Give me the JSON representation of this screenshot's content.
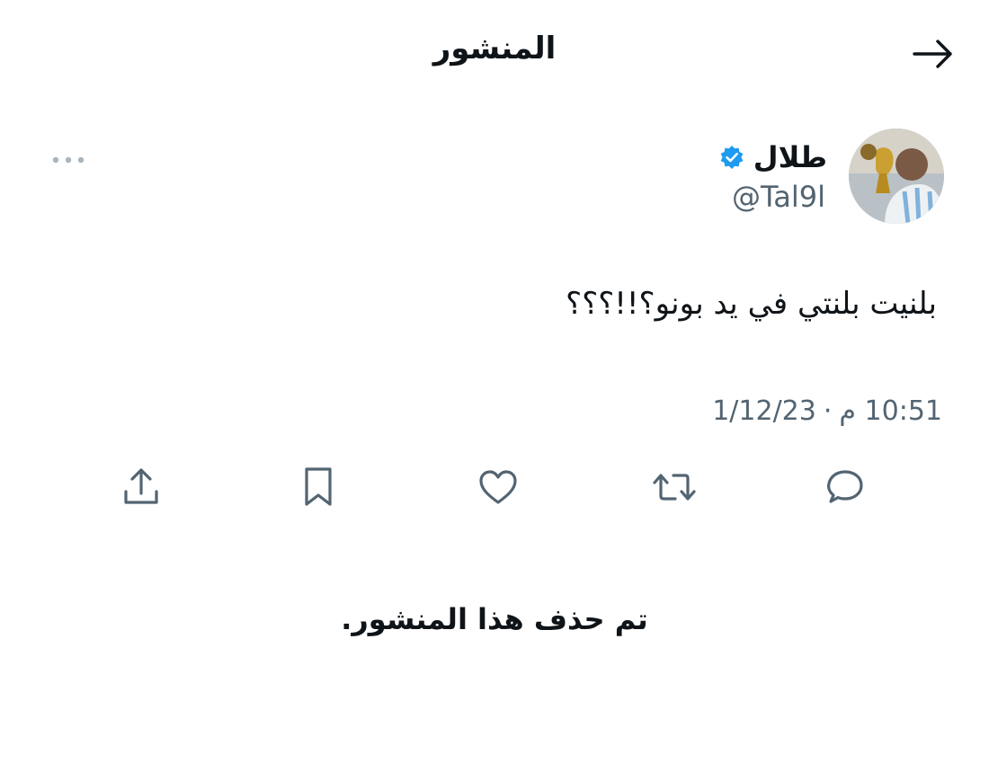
{
  "header": {
    "title": "المنشور",
    "back_icon": "arrow-right-icon",
    "more_icon": "more-horizontal-icon"
  },
  "author": {
    "display_name": "طلال",
    "handle": "@Tal9l",
    "verified_icon": "verified-badge-icon",
    "verified_color": "#1d9bf0"
  },
  "tweet": {
    "text": "بلنيت بلنتي في يد بونو؟!!؟؟؟",
    "timestamp_date": "1/12/23",
    "timestamp_separator": "·",
    "timestamp_time": "10:51 م"
  },
  "actions": [
    {
      "name": "reply",
      "icon": "comment-icon"
    },
    {
      "name": "retweet",
      "icon": "retweet-icon"
    },
    {
      "name": "like",
      "icon": "heart-icon"
    },
    {
      "name": "bookmark",
      "icon": "bookmark-icon"
    },
    {
      "name": "share",
      "icon": "share-icon"
    }
  ],
  "status": {
    "deleted_message": "تم حذف هذا المنشور."
  },
  "colors": {
    "text_primary": "#0f1419",
    "text_secondary": "#536471",
    "icon_color": "#536471",
    "accent": "#1d9bf0"
  }
}
